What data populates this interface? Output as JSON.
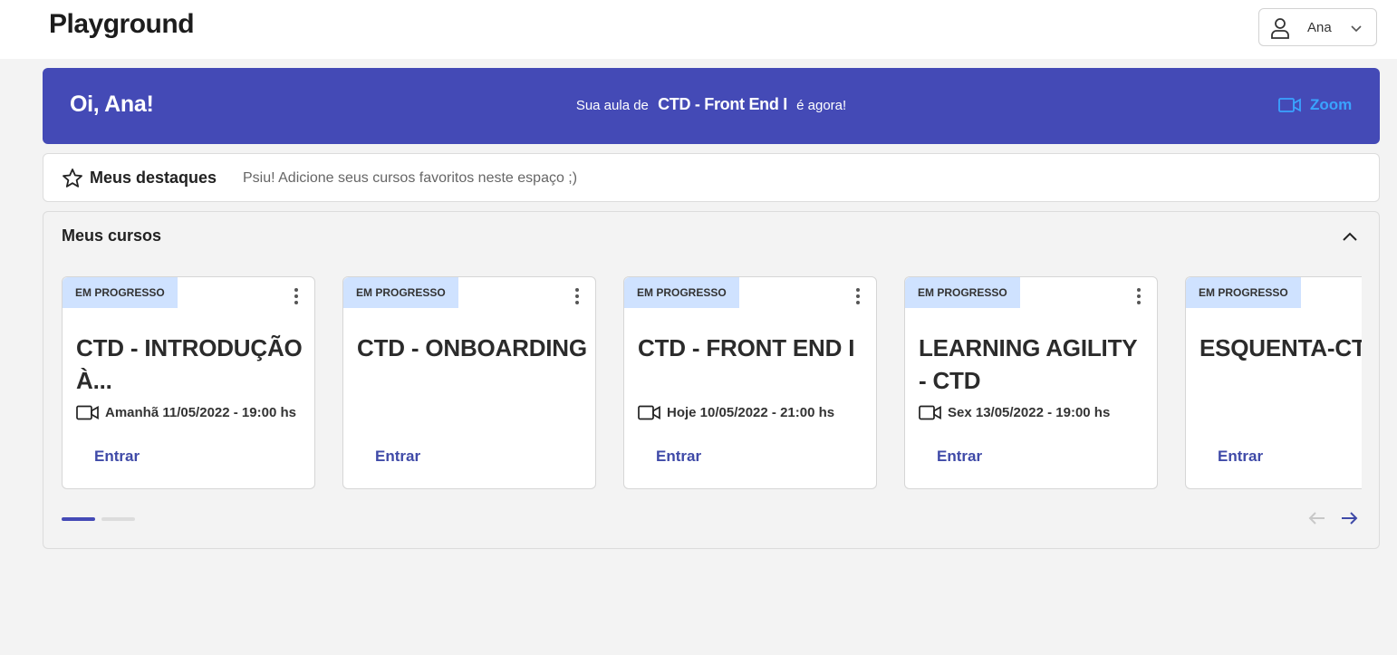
{
  "header": {
    "brand": "Playground",
    "user_name": "Ana"
  },
  "hero": {
    "greeting": "Oi, Ana!",
    "message_before": "Sua aula de",
    "course": "CTD - Front End I",
    "message_after": "é agora!",
    "zoom_label": "Zoom",
    "zoom_color": "#3aa3ff",
    "background_color": "#444ab6"
  },
  "highlights": {
    "title": "Meus destaques",
    "hint": "Psiu! Adicione seus cursos favoritos neste espaço ;)"
  },
  "courses": {
    "title": "Meus cursos",
    "cards": [
      {
        "badge": "EM PROGRESSO",
        "name": "CTD - INTRODUÇÃO À...",
        "schedule": "Amanhã 11/05/2022 - 19:00 hs",
        "action": "Entrar"
      },
      {
        "badge": "EM PROGRESSO",
        "name": "CTD - ONBOARDING",
        "schedule": "",
        "action": "Entrar"
      },
      {
        "badge": "EM PROGRESSO",
        "name": "CTD - FRONT END I",
        "schedule": "Hoje 10/05/2022 - 21:00 hs",
        "action": "Entrar"
      },
      {
        "badge": "EM PROGRESSO",
        "name": "LEARNING AGILITY - CTD",
        "schedule": "Sex 13/05/2022 - 19:00 hs",
        "action": "Entrar"
      },
      {
        "badge": "EM PROGRESSO",
        "name": "ESQUENTA-CTD",
        "schedule": "",
        "action": "Entrar"
      }
    ],
    "pagination": {
      "pages": 2,
      "current": 1
    }
  },
  "icons": {
    "user": "user-icon",
    "chevron": "chevron-down-icon",
    "video": "video-camera-icon",
    "star": "star-outline-icon",
    "collapse": "chevron-up-icon",
    "more": "more-vertical-icon",
    "prev": "arrow-left-icon",
    "next": "arrow-right-icon"
  },
  "colors": {
    "badge_bg": "#cfe2ff",
    "link": "#3f4aa8"
  }
}
